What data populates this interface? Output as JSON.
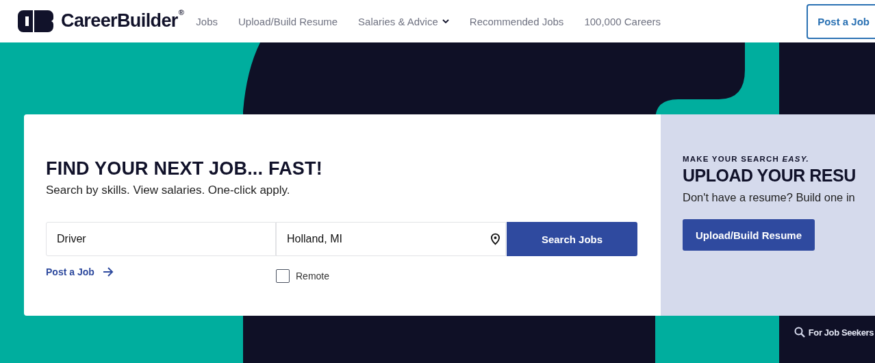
{
  "header": {
    "logo": "CareerBuilder",
    "logo_mark": "®",
    "nav": [
      {
        "label": "Jobs",
        "dropdown": false
      },
      {
        "label": "Upload/Build Resume",
        "dropdown": false
      },
      {
        "label": "Salaries & Advice",
        "dropdown": true
      },
      {
        "label": "Recommended Jobs",
        "dropdown": false
      },
      {
        "label": "100,000 Careers",
        "dropdown": false
      }
    ],
    "post_button": "Post a Job"
  },
  "search_card": {
    "title": "FIND YOUR NEXT JOB... FAST!",
    "subtitle": "Search by skills. View salaries. One-click apply.",
    "keyword": "Driver",
    "location": "Holland, MI",
    "search_button": "Search Jobs",
    "post_link": "Post a Job",
    "remote": {
      "label": "Remote",
      "checked": false
    }
  },
  "resume_panel": {
    "eyebrow": "MAKE YOUR SEARCH *EASY.*",
    "title": "UPLOAD YOUR RESU",
    "text": "Don't have a resume? Build one in",
    "button": "Upload/Build Resume"
  },
  "job_seekers_link": "For Job Seekers"
}
